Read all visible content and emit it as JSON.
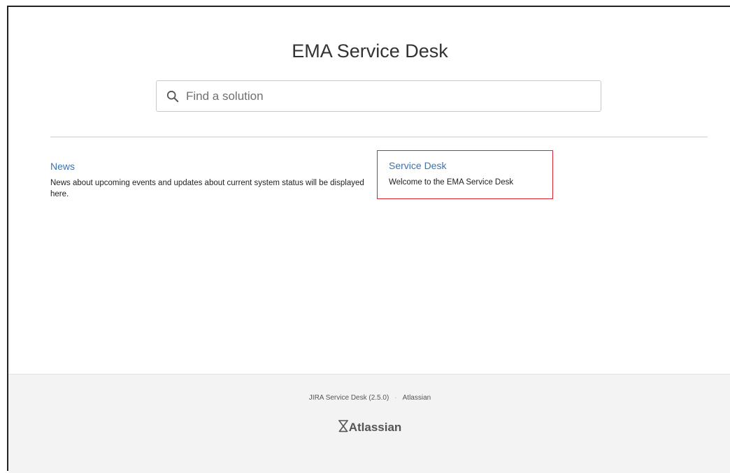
{
  "header": {
    "title": "EMA Service Desk"
  },
  "search": {
    "placeholder": "Find a solution",
    "icon": "search-icon"
  },
  "cards": [
    {
      "title": "News",
      "description": "News about upcoming events and updates about current system status will be displayed here."
    },
    {
      "title": "Service Desk",
      "description": "Welcome to the EMA Service Desk",
      "highlight_color": "#d9232e"
    }
  ],
  "footer": {
    "product": "JIRA Service Desk (2.5.0)",
    "separator": "·",
    "company_link": "Atlassian",
    "logo_text": "Atlassian",
    "logo_icon": "atlassian-logo-icon"
  },
  "colors": {
    "link": "#3b73af",
    "footer_bg": "#f3f3f3"
  }
}
